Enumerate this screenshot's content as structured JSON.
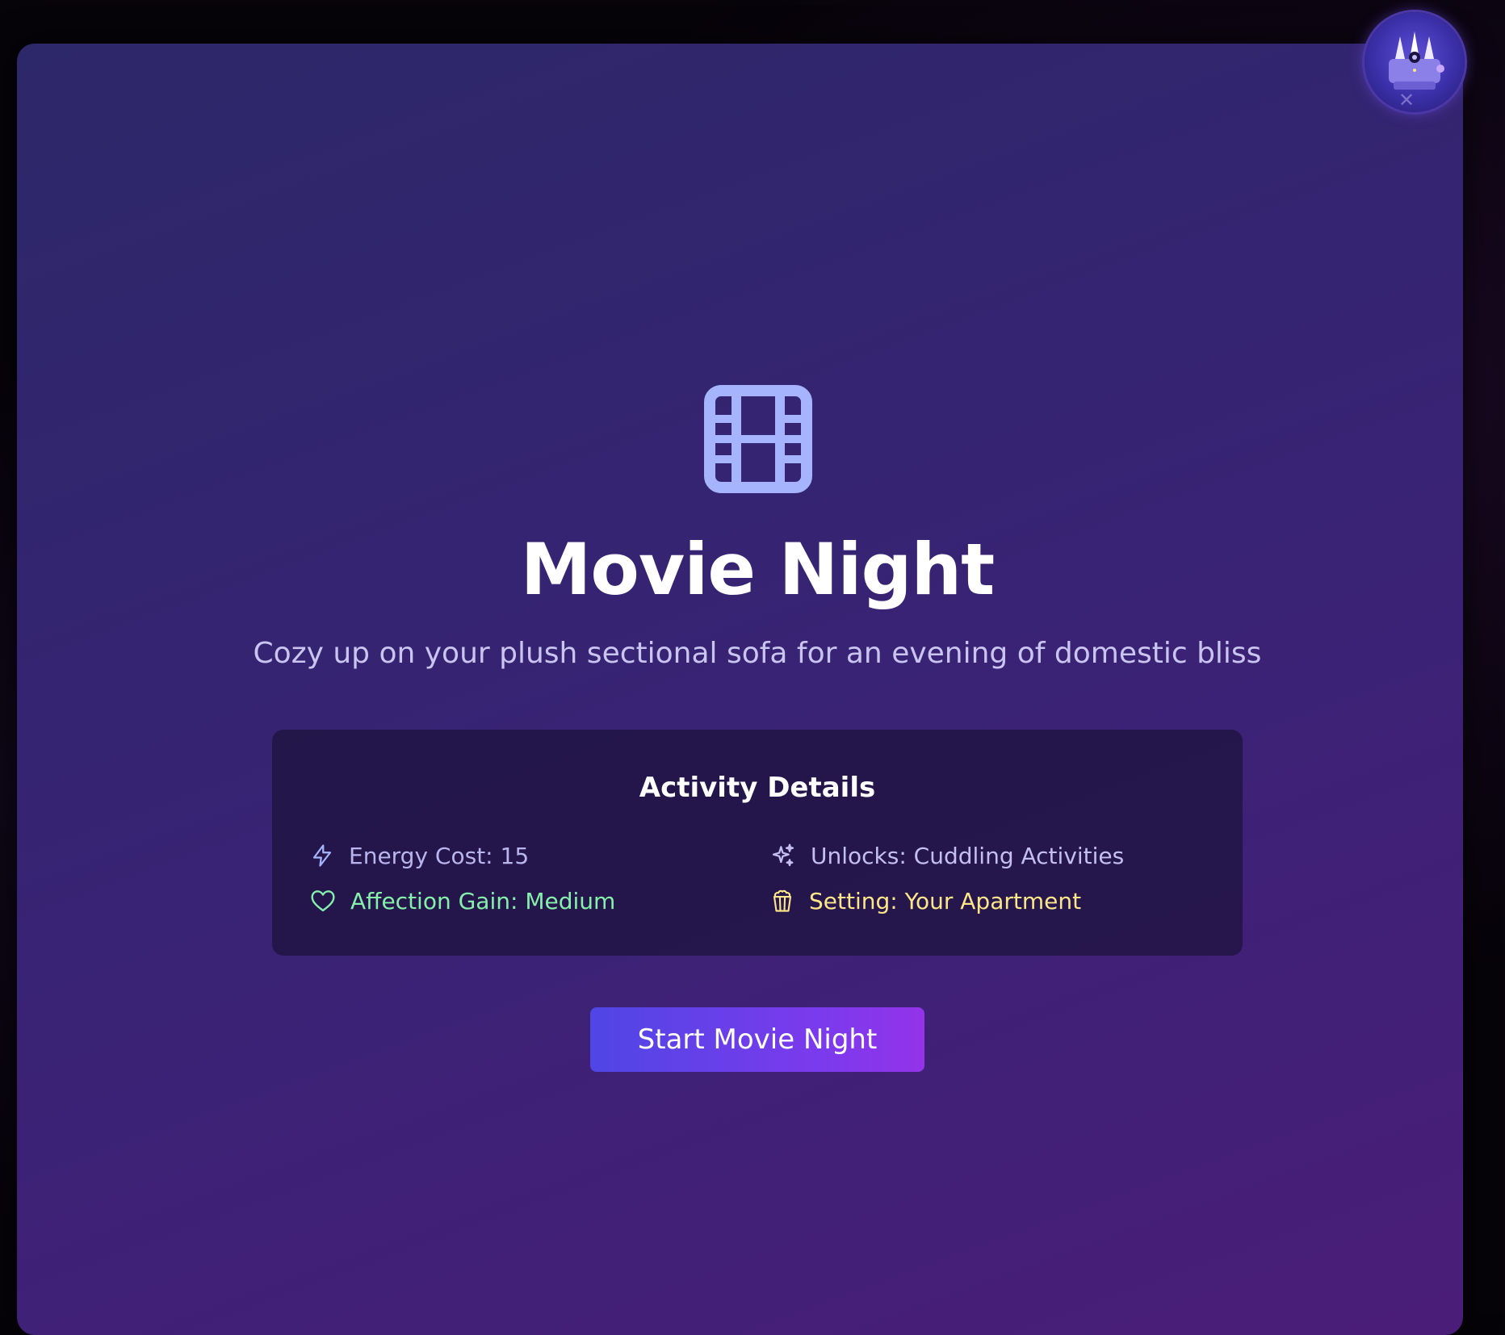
{
  "activity": {
    "title": "Movie Night",
    "description": "Cozy up on your plush sectional sofa for an evening of domestic bliss",
    "icon": "film-icon"
  },
  "details": {
    "heading": "Activity Details",
    "energy": "Energy Cost: 15",
    "unlocks": "Unlocks: Cuddling Activities",
    "affection": "Affection Gain: Medium",
    "setting": "Setting: Your Apartment"
  },
  "actions": {
    "start_label": "Start Movie Night",
    "close_symbol": "✕"
  },
  "colors": {
    "icon_accent": "#a5b4fc",
    "affection": "#86efac",
    "setting": "#fde68a",
    "button_start": "#4f46e5",
    "button_end": "#9333ea"
  }
}
